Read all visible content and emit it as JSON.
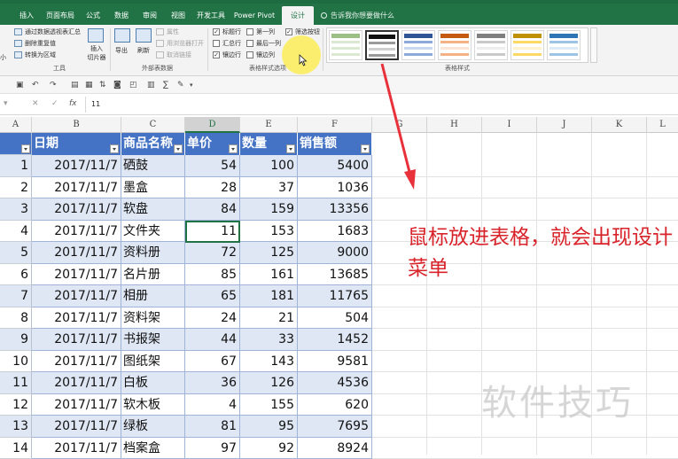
{
  "ribbon": {
    "tabs": [
      "插入",
      "页面布局",
      "公式",
      "数据",
      "审阅",
      "视图",
      "开发工具",
      "Power Pivot",
      "设计"
    ],
    "active_tab": "设计",
    "tell_me": "告诉我你想要做什么",
    "tools_group": {
      "items": [
        "通过数据透视表汇总",
        "删除重复值",
        "转换为区域"
      ],
      "left_fragment": "小",
      "insert_slicer": "插入\n切片器",
      "label": "工具"
    },
    "external_group": {
      "export": "导出",
      "refresh": "刷新",
      "items": [
        "属性",
        "用浏览器打开",
        "取消链接"
      ],
      "label": "外部表数据"
    },
    "style_options_group": {
      "checks": [
        {
          "label": "标题行",
          "checked": true
        },
        {
          "label": "第一列",
          "checked": false
        },
        {
          "label": "筛选按钮",
          "checked": true
        },
        {
          "label": "汇总行",
          "checked": false
        },
        {
          "label": "最后一列",
          "checked": false
        },
        {
          "label": "镶边行",
          "checked": true
        },
        {
          "label": "镶边列",
          "checked": false
        }
      ],
      "label": "表格样式选项"
    },
    "table_styles_label": "表格样式"
  },
  "formula_bar": {
    "value": "11"
  },
  "columns": [
    "A",
    "B",
    "C",
    "D",
    "E",
    "F",
    "G",
    "H",
    "I",
    "J",
    "K",
    "L"
  ],
  "selected_column": "D",
  "table": {
    "headers": [
      "日期",
      "商品名称",
      "单价",
      "数量",
      "销售额"
    ],
    "rows": [
      {
        "n": "1",
        "date": "2017/11/7",
        "name": "硒鼓",
        "price": "54",
        "qty": "100",
        "sales": "5400"
      },
      {
        "n": "2",
        "date": "2017/11/7",
        "name": "墨盒",
        "price": "28",
        "qty": "37",
        "sales": "1036"
      },
      {
        "n": "3",
        "date": "2017/11/7",
        "name": "软盘",
        "price": "84",
        "qty": "159",
        "sales": "13356"
      },
      {
        "n": "4",
        "date": "2017/11/7",
        "name": "文件夹",
        "price": "11",
        "qty": "153",
        "sales": "1683"
      },
      {
        "n": "5",
        "date": "2017/11/7",
        "name": "资料册",
        "price": "72",
        "qty": "125",
        "sales": "9000"
      },
      {
        "n": "6",
        "date": "2017/11/7",
        "name": "名片册",
        "price": "85",
        "qty": "161",
        "sales": "13685"
      },
      {
        "n": "7",
        "date": "2017/11/7",
        "name": "相册",
        "price": "65",
        "qty": "181",
        "sales": "11765"
      },
      {
        "n": "8",
        "date": "2017/11/7",
        "name": "资料架",
        "price": "24",
        "qty": "21",
        "sales": "504"
      },
      {
        "n": "9",
        "date": "2017/11/7",
        "name": "书报架",
        "price": "44",
        "qty": "33",
        "sales": "1452"
      },
      {
        "n": "10",
        "date": "2017/11/7",
        "name": "图纸架",
        "price": "67",
        "qty": "143",
        "sales": "9581"
      },
      {
        "n": "11",
        "date": "2017/11/7",
        "name": "白板",
        "price": "36",
        "qty": "126",
        "sales": "4536"
      },
      {
        "n": "12",
        "date": "2017/11/7",
        "name": "软木板",
        "price": "4",
        "qty": "155",
        "sales": "620"
      },
      {
        "n": "13",
        "date": "2017/11/7",
        "name": "绿板",
        "price": "81",
        "qty": "95",
        "sales": "7695"
      },
      {
        "n": "14",
        "date": "2017/11/7",
        "name": "档案盒",
        "price": "97",
        "qty": "92",
        "sales": "8924"
      }
    ]
  },
  "annotation": "鼠标放进表格，就会出现设计菜单",
  "watermark": "软件技巧",
  "colors": {
    "excel_green": "#217346",
    "table_header_blue": "#4472c4",
    "band_blue": "#dfe7f4",
    "annotation_red": "#d9232a"
  }
}
